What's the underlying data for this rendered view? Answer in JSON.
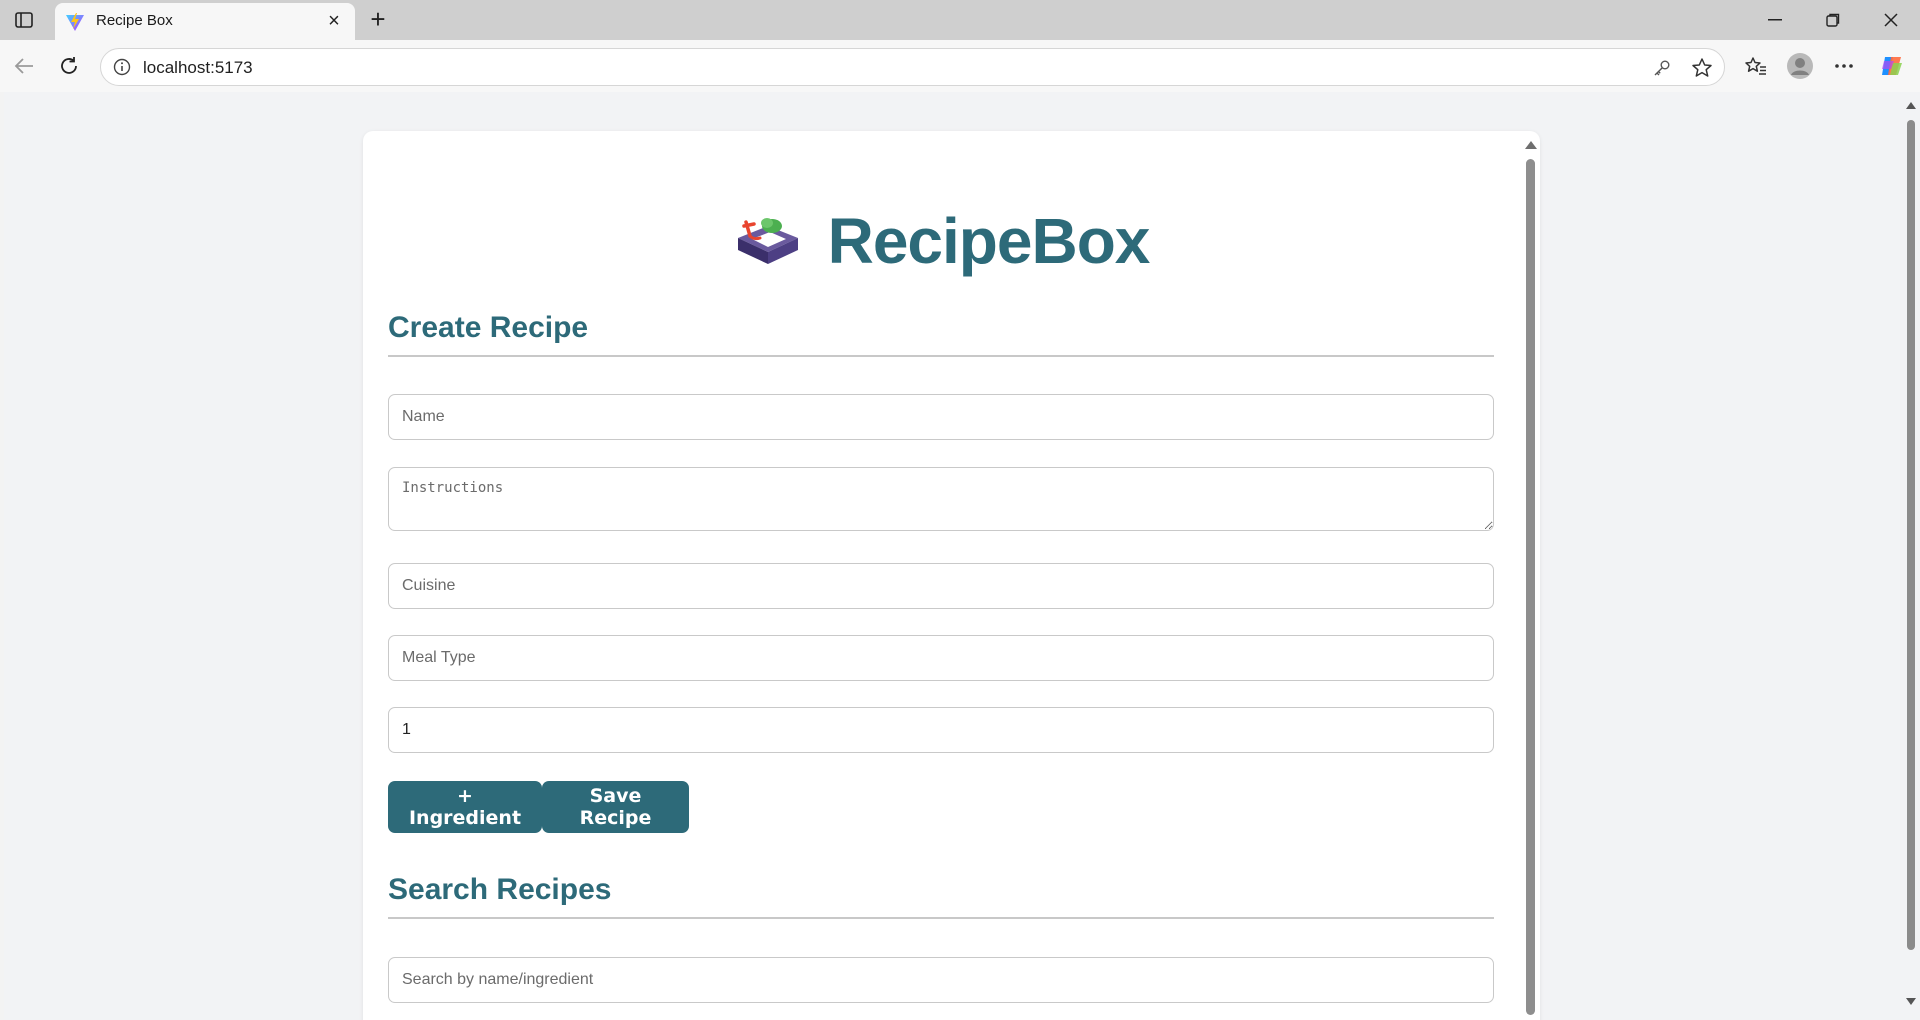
{
  "browser": {
    "tab_title": "Recipe Box",
    "url": "localhost:5173"
  },
  "app": {
    "brand_title": "RecipeBox",
    "brand_icon": "recipe-box-icon",
    "accent_color": "#2d6a79"
  },
  "create_section": {
    "heading": "Create Recipe",
    "fields": {
      "name_placeholder": "Name",
      "instructions_placeholder": "Instructions",
      "cuisine_placeholder": "Cuisine",
      "meal_type_placeholder": "Meal Type",
      "servings_value": "1"
    },
    "buttons": {
      "add_ingredient": "+ Ingredient",
      "save_recipe": "Save Recipe"
    }
  },
  "search_section": {
    "heading": "Search Recipes",
    "search_placeholder": "Search by name/ingredient"
  }
}
